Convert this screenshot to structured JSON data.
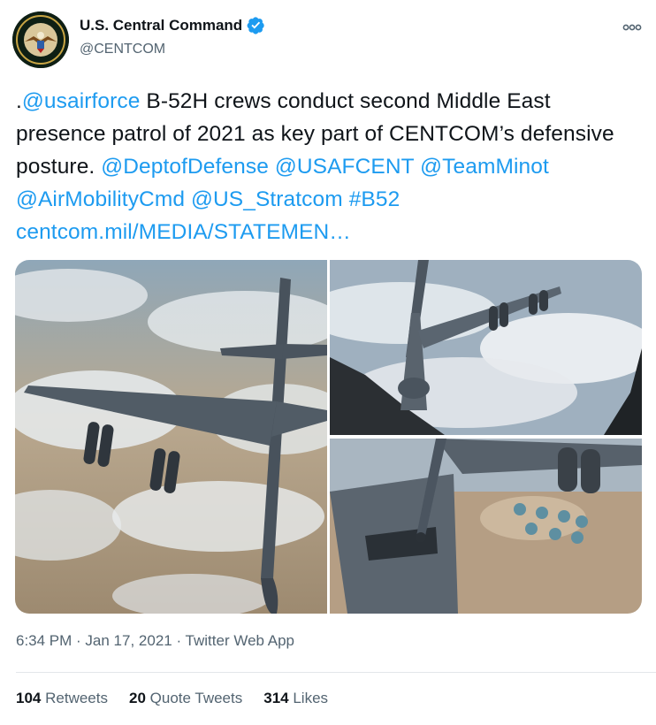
{
  "author": {
    "name": "U.S. Central Command",
    "handle": "@CENTCOM",
    "verified": true,
    "avatar_icon": "centcom-seal-icon"
  },
  "tweet": {
    "segments": [
      {
        "text": ".",
        "link": false
      },
      {
        "text": "@usairforce",
        "link": true
      },
      {
        "text": " B-52H crews conduct second Middle East presence patrol of 2021 as key part of CENTCOM’s defensive posture. ",
        "link": false
      },
      {
        "text": "@DeptofDefense",
        "link": true
      },
      {
        "text": " ",
        "link": false
      },
      {
        "text": "@USAFCENT",
        "link": true
      },
      {
        "text": " ",
        "link": false
      },
      {
        "text": "@TeamMinot",
        "link": true
      },
      {
        "text": " ",
        "link": false
      },
      {
        "text": "@AirMobilityCmd",
        "link": true
      },
      {
        "text": " ",
        "link": false
      },
      {
        "text": "@US_Stratcom",
        "link": true
      },
      {
        "text": " ",
        "link": false
      },
      {
        "text": "#B52",
        "link": true
      },
      {
        "text": " ",
        "link": false
      },
      {
        "text": "centcom.mil/MEDIA/STATEMEN…",
        "link": true
      }
    ]
  },
  "media": {
    "photos": [
      "b52-from-above",
      "b52-refueling-boom",
      "b52-cockpit-closeup"
    ]
  },
  "meta": {
    "time": "6:34 PM",
    "sep1": " · ",
    "date": "Jan 17, 2021",
    "sep2": " · ",
    "app": "Twitter Web App"
  },
  "stats": {
    "retweets_count": "104",
    "retweets_label": "Retweets",
    "quotes_count": "20",
    "quotes_label": "Quote Tweets",
    "likes_count": "314",
    "likes_label": "Likes"
  },
  "colors": {
    "link": "#1d9bf0",
    "secondary_text": "#536471",
    "verified": "#1d9bf0"
  }
}
